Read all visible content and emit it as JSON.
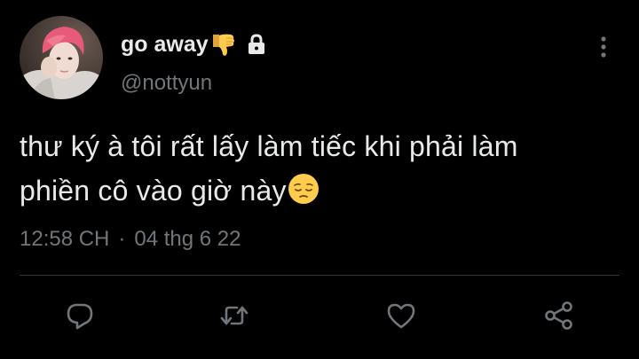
{
  "user": {
    "display_name": "go away",
    "name_emoji": "thumbs-down-emoji",
    "locked": true,
    "handle": "@nottyun"
  },
  "tweet": {
    "text_line1": "thư ký à tôi rất lấy làm tiếc khi phải làm",
    "text_line2": "phiền cô vào giờ này",
    "trailing_emoji": "pensive-face-emoji",
    "time": "12:58 CH",
    "separator": "·",
    "date": "04 thg 6 22"
  },
  "actions": [
    {
      "name": "reply",
      "icon": "reply-icon"
    },
    {
      "name": "retweet",
      "icon": "retweet-icon"
    },
    {
      "name": "like",
      "icon": "heart-icon"
    },
    {
      "name": "share",
      "icon": "share-icon"
    }
  ],
  "colors": {
    "background": "#000000",
    "text_primary": "#e7e9ea",
    "text_secondary": "#71767b",
    "divider": "#2f3336",
    "icon_gray": "#71767b",
    "emoji_yellow": "#ffcc4d"
  }
}
